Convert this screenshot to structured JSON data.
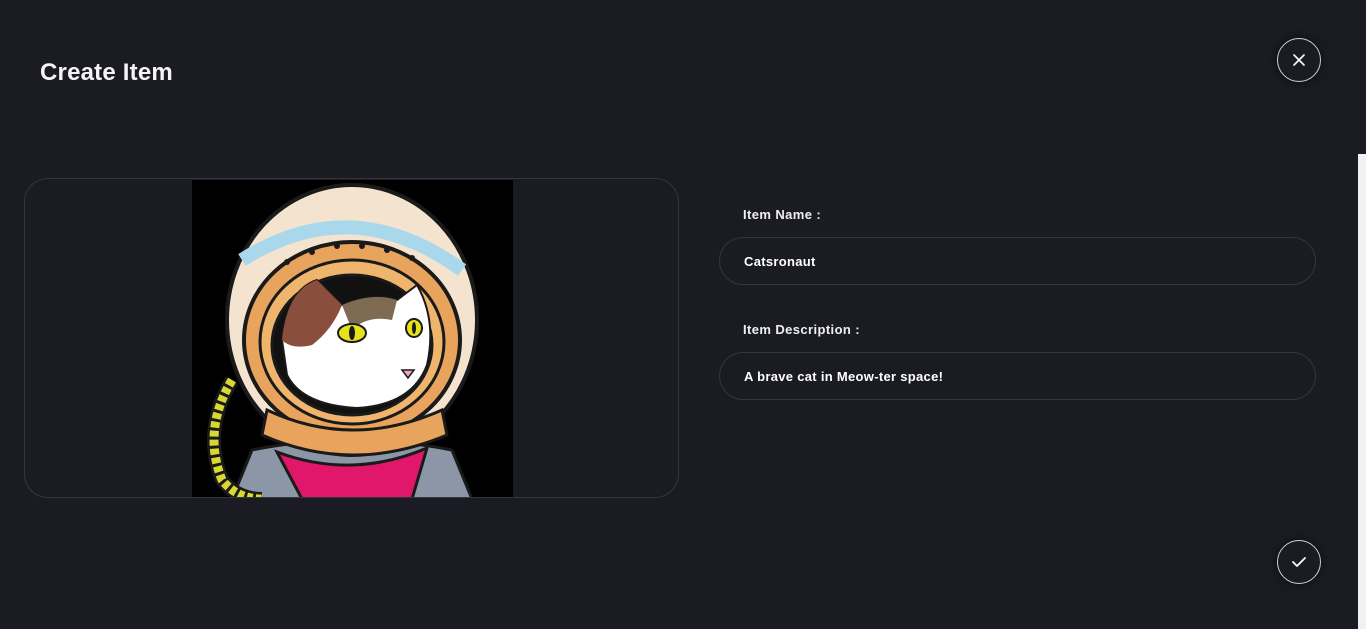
{
  "dialog": {
    "title": "Create Item"
  },
  "form": {
    "name_label": "Item Name :",
    "name_value": "Catsronaut",
    "description_label": "Item Description :",
    "description_value": "A brave cat in Meow-ter space!"
  },
  "image": {
    "subject": "astronaut cat illustration"
  },
  "icons": {
    "close": "close-icon",
    "confirm": "checkmark-icon"
  },
  "colors": {
    "background": "#1b1c23",
    "border": "#34353d",
    "button_border": "#cfd0d6",
    "text": "#ffffff"
  }
}
